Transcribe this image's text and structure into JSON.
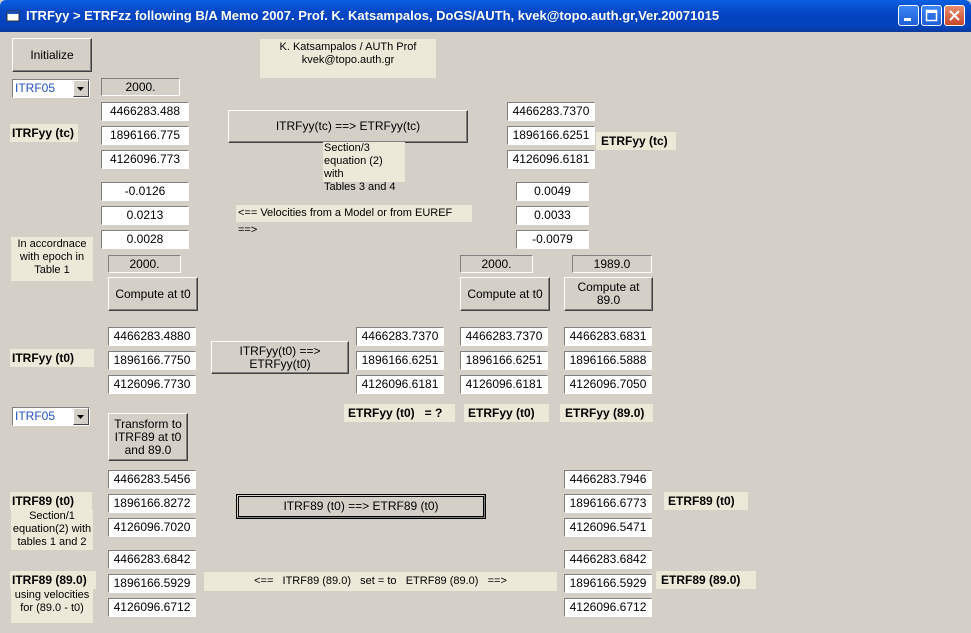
{
  "window": {
    "title": "ITRFyy > ETRFzz following B/A Memo 2007. Prof. K. Katsampalos,  DoGS/AUTh, kvek@topo.auth.gr,Ver.20071015"
  },
  "author": {
    "line1": "K. Katsampalos / AUTh Prof",
    "line2": "kvek@topo.auth.gr"
  },
  "initialize_label": "Initialize",
  "combo1": "ITRF05",
  "combo2": "ITRF05",
  "epoch_tc": "2000.",
  "itrf_tc": {
    "label": "ITRFyy (tc)",
    "x": "4466283.488",
    "y": "1896166.775",
    "z": "4126096.773"
  },
  "etrf_tc": {
    "label": "ETRFyy (tc)",
    "x": "4466283.7370",
    "y": "1896166.6251",
    "z": "4126096.6181"
  },
  "transform_tc_label": "ITRFyy(tc) ==> ETRFyy(tc)",
  "section3": {
    "l1": "Section/3",
    "l2": "equation (2) with",
    "l3": "Tables 3 and 4"
  },
  "vel_left": {
    "vx": "-0.0126",
    "vy": "0.0213",
    "vz": "0.0028"
  },
  "vel_right": {
    "vx": "0.0049",
    "vy": "0.0033",
    "vz": "-0.0079"
  },
  "velocities_label": "<==  Velocities from a Model or from EUREF ==>",
  "accordance": {
    "l1": "In accordnace",
    "l2": "with epoch in",
    "l3": "Table 1"
  },
  "epoch_t0_left": "2000.",
  "epoch_t0_right": "2000.",
  "epoch_89": "1989.0",
  "compute_t0_label": "Compute at t0",
  "compute_t0_right_label": "Compute at t0",
  "compute_89_label": "Compute at 89.0",
  "itrf_t0": {
    "label": "ITRFyy (t0)",
    "x": "4466283.4880",
    "y": "1896166.7750",
    "z": "4126096.7730"
  },
  "transform_t0_label": "ITRFyy(t0) ==> ETRFyy(t0)",
  "etrf_t0_mid": {
    "label": "ETRFyy (t0)   = ?",
    "x": "4466283.7370",
    "y": "1896166.6251",
    "z": "4126096.6181"
  },
  "etrf_t0_right": {
    "label": "ETRFyy (t0)",
    "x": "4466283.7370",
    "y": "1896166.6251",
    "z": "4126096.6181"
  },
  "etrf_89_col": {
    "label": "ETRFyy (89.0)",
    "x": "4466283.6831",
    "y": "1896166.5888",
    "z": "4126096.7050"
  },
  "transform89": {
    "l1": "Transform to",
    "l2": "ITRF89 at t0",
    "l3": "and 89.0"
  },
  "itrf89_t0": {
    "label": "ITRF89 (t0)",
    "x": "4466283.5456",
    "y": "1896166.8272",
    "z": "4126096.7020"
  },
  "section1": {
    "l1": "Section/1",
    "l2": "equation(2) with",
    "l3": "tables 1 and 2"
  },
  "itrf89_to_etrf89_label": "ITRF89 (t0) ==> ETRF89 (t0)",
  "etrf89_t0": {
    "label": "ETRF89 (t0)",
    "x": "4466283.7946",
    "y": "1896166.6773",
    "z": "4126096.5471"
  },
  "itrf89_89": {
    "label": "ITRF89 (89.0)",
    "x": "4466283.6842",
    "y": "1896166.5929",
    "z": "4126096.6712"
  },
  "using_vel": {
    "l1": "using velocities",
    "l2": "for (89.0 - t0)"
  },
  "set_to_label": "<==   ITRF89 (89.0)   set = to   ETRF89 (89.0)   ==>",
  "etrf89_89": {
    "label": "ETRF89 (89.0)",
    "x": "4466283.6842",
    "y": "1896166.5929",
    "z": "4126096.6712"
  }
}
